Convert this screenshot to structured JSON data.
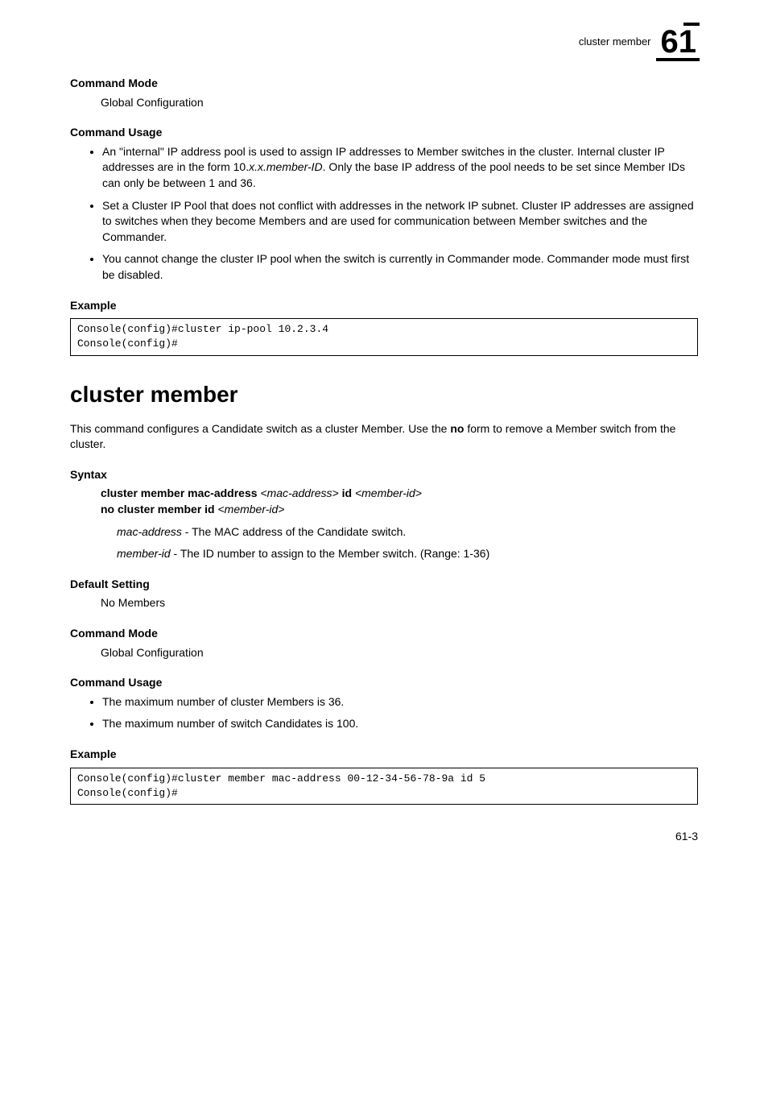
{
  "header": {
    "breadcrumb": "cluster member",
    "chapter_number": "61"
  },
  "section1": {
    "command_mode_heading": "Command Mode",
    "command_mode_text": "Global Configuration",
    "command_usage_heading": "Command Usage",
    "usage_bullets": [
      "An \"internal\" IP address pool is used to assign IP addresses to Member switches in the cluster. Internal cluster IP addresses are in the form 10.x.x.member-ID. Only the base IP address of the pool needs to be set since Member IDs can only be between 1 and 36.",
      "Set a Cluster IP Pool that does not conflict with addresses in the network IP subnet. Cluster IP addresses are assigned to switches when they become Members and are used for communication between Member switches and the Commander.",
      "You cannot change the cluster IP pool when the switch is currently in Commander mode. Commander mode must first be disabled."
    ],
    "example_heading": "Example",
    "example_code": "Console(config)#cluster ip-pool 10.2.3.4\nConsole(config)#"
  },
  "section2": {
    "title": "cluster member",
    "description_part1": "This command configures a Candidate switch as a cluster Member. Use the ",
    "description_bold": "no",
    "description_part2": " form to remove a Member switch from the cluster.",
    "syntax_heading": "Syntax",
    "syntax_line1_prefix": "cluster member mac-address",
    "syntax_line1_arg1": "<mac-address>",
    "syntax_line1_mid": "id",
    "syntax_line1_arg2": "<member-id>",
    "syntax_line2_prefix": "no cluster member id",
    "syntax_line2_arg": "<member-id>",
    "param1_name": "mac-address",
    "param1_desc": " - The MAC address of the Candidate switch.",
    "param2_name": "member-id",
    "param2_desc": " - The ID number to assign to the Member switch. (Range: 1-36)",
    "default_setting_heading": "Default Setting",
    "default_setting_text": "No Members",
    "command_mode_heading": "Command Mode",
    "command_mode_text": "Global Configuration",
    "command_usage_heading": "Command Usage",
    "usage_bullets": [
      "The maximum number of cluster Members is 36.",
      "The maximum number of switch Candidates is 100."
    ],
    "example_heading": "Example",
    "example_code": "Console(config)#cluster member mac-address 00-12-34-56-78-9a id 5\nConsole(config)#"
  },
  "footer": {
    "page": "61-3"
  }
}
